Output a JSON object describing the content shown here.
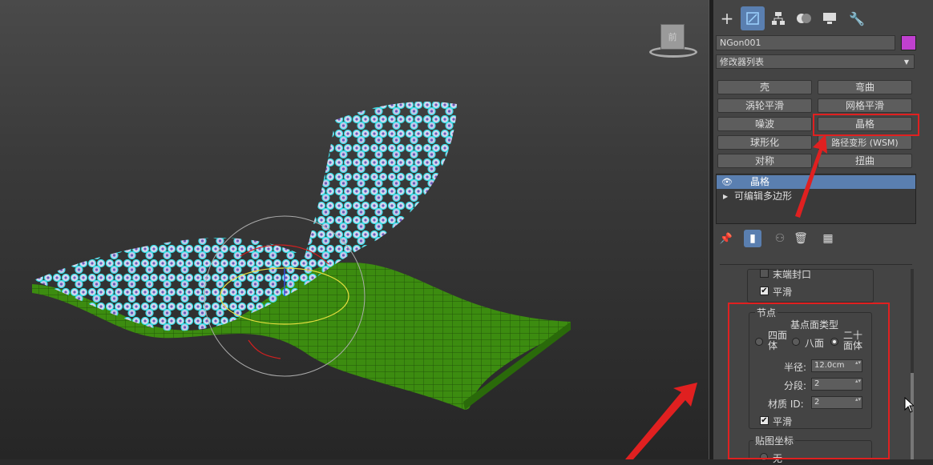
{
  "command_panel": {
    "tabs": [
      {
        "name": "create-tab",
        "icon": "plus-icon"
      },
      {
        "name": "modify-tab",
        "icon": "modify-icon"
      },
      {
        "name": "hierarchy-tab",
        "icon": "hierarchy-icon"
      },
      {
        "name": "motion-tab",
        "icon": "motion-icon"
      },
      {
        "name": "display-tab",
        "icon": "display-icon"
      },
      {
        "name": "utilities-tab",
        "icon": "wrench-icon"
      }
    ],
    "object_name": "NGon001",
    "object_color": "#c040d0",
    "modifier_list_label": "修改器列表",
    "modifier_buttons": [
      "壳",
      "弯曲",
      "涡轮平滑",
      "网格平滑",
      "噪波",
      "晶格",
      "球形化",
      "路径变形 (WSM)",
      "对称",
      "扭曲"
    ],
    "modifier_stack": [
      {
        "label": "晶格",
        "selected": true
      },
      {
        "label": "可编辑多边形",
        "selected": false
      }
    ]
  },
  "parameters": {
    "end_caps_label": "末端封口",
    "smooth_label_1": "平滑",
    "nodes_group_label": "节点",
    "geodesic_type_label": "基点面类型",
    "option_tetra": "四面体",
    "option_octa": "八面",
    "option_icosa": "二十面体",
    "radius_label": "半径:",
    "radius_value": "12.0cm",
    "segments_label": "分段:",
    "segments_value": "2",
    "material_id_label": "材质 ID:",
    "material_id_value": "2",
    "smooth_label_2": "平滑",
    "mapping_group_label": "贴图坐标",
    "mapping_none_label": "无"
  },
  "viewcube_label": "前",
  "colors": {
    "highlight": "#e02020",
    "selection_blue": "#5a7fb0",
    "mesh_green": "#3c8c10",
    "lattice_cyan": "#35e0e8"
  }
}
